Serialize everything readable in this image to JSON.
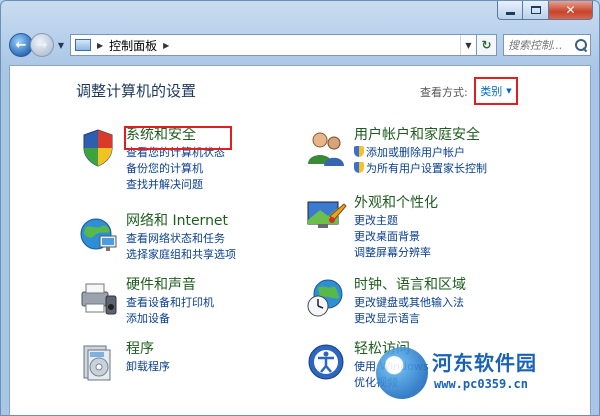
{
  "window": {
    "close_glyph": "✕"
  },
  "nav": {
    "back_glyph": "←",
    "forward_glyph": "→",
    "address_icon": "control-panel-icon",
    "breadcrumb_sep": "▶",
    "breadcrumb": "控制面板",
    "breadcrumb_trail": "▶",
    "address_dropdown": "▼",
    "refresh_glyph": "↻",
    "search_placeholder": "搜索控制..."
  },
  "header": {
    "title": "调整计算机的设置",
    "view_by_label": "查看方式:",
    "view_by_value": "类别",
    "view_by_arrow": "▼"
  },
  "categories": [
    {
      "title": "系统和安全",
      "icon": "system-security-icon",
      "links": [
        "查看您的计算机状态",
        "备份您的计算机",
        "查找并解决问题"
      ]
    },
    {
      "title": "网络和 Internet",
      "icon": "network-icon",
      "links": [
        "查看网络状态和任务",
        "选择家庭组和共享选项"
      ]
    },
    {
      "title": "硬件和声音",
      "icon": "hardware-sound-icon",
      "links": [
        "查看设备和打印机",
        "添加设备"
      ]
    },
    {
      "title": "程序",
      "icon": "programs-icon",
      "links": [
        "卸载程序"
      ]
    },
    {
      "title": "用户帐户和家庭安全",
      "icon": "user-accounts-icon",
      "links": [
        "添加或删除用户帐户",
        "为所有用户设置家长控制"
      ]
    },
    {
      "title": "外观和个性化",
      "icon": "appearance-icon",
      "links": [
        "更改主题",
        "更改桌面背景",
        "调整屏幕分辨率"
      ]
    },
    {
      "title": "时钟、语言和区域",
      "icon": "clock-language-icon",
      "links": [
        "更改键盘或其他输入法",
        "更改显示语言"
      ]
    },
    {
      "title": "轻松访问",
      "icon": "ease-of-access-icon",
      "links": [
        "使用 Windows",
        "优化视频"
      ]
    }
  ],
  "watermark": {
    "title": "河东软件园",
    "url": "www.pc0359.cn"
  },
  "colors": {
    "category_title": "#1e5d1e",
    "link": "#0a3f8f",
    "highlight_box": "#e02020",
    "watermark": "#1a62b8"
  }
}
